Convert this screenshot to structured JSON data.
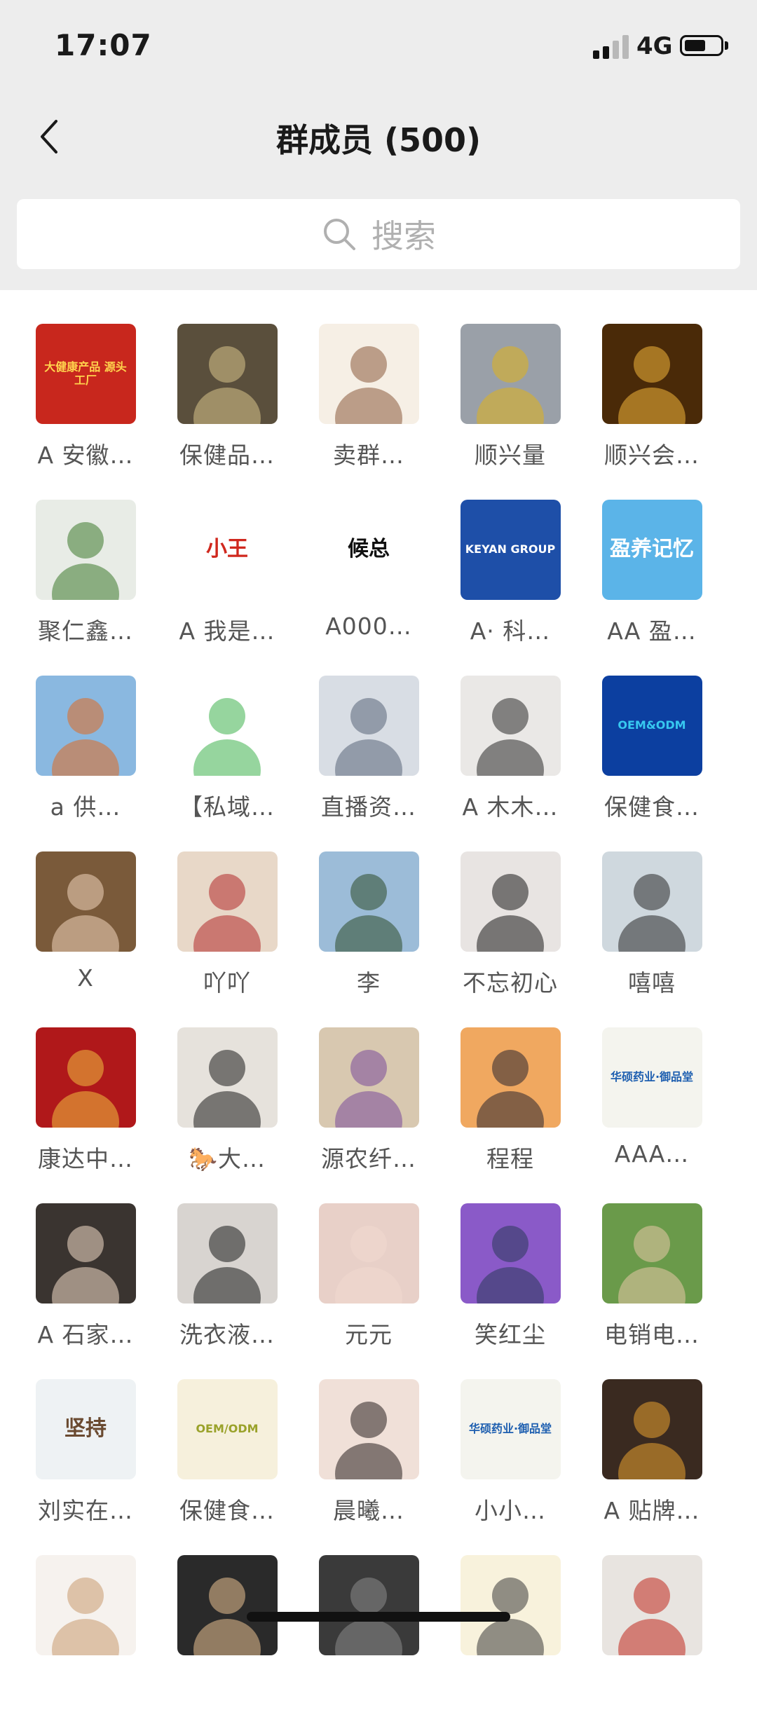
{
  "status_bar": {
    "time": "17:07",
    "network": "4G",
    "battery_level": 0.58
  },
  "header": {
    "title": "群成员 (500)",
    "back_icon": "chevron-left-icon"
  },
  "search": {
    "placeholder": "搜索",
    "icon": "search-icon"
  },
  "members": [
    {
      "name": "A 安徽…",
      "avatar_text": "大健康产品 源头工厂",
      "colors": [
        "#c8271d",
        "#ffd34d"
      ]
    },
    {
      "name": "保健品…",
      "avatar_text": "",
      "colors": [
        "#5a4f3c",
        "#d8c58a"
      ]
    },
    {
      "name": "卖群…",
      "avatar_text": "",
      "colors": [
        "#f6efe5",
        "#8a5a3c"
      ]
    },
    {
      "name": "顺兴量",
      "avatar_text": "",
      "colors": [
        "#9aa0a8",
        "#e0b21a"
      ]
    },
    {
      "name": "顺兴会…",
      "avatar_text": "",
      "colors": [
        "#4a2a08",
        "#f2b43a"
      ]
    },
    {
      "name": "聚仁鑫…",
      "avatar_text": "",
      "colors": [
        "#e8ece6",
        "#3d7a2b"
      ]
    },
    {
      "name": "A 我是…",
      "avatar_text": "小王",
      "colors": [
        "#ffffff",
        "#d0281e"
      ]
    },
    {
      "name": "A000…",
      "avatar_text": "候总",
      "colors": [
        "#ffffff",
        "#111111"
      ]
    },
    {
      "name": "A· 科…",
      "avatar_text": "KEYAN GROUP",
      "colors": [
        "#1e4fa8",
        "#ffffff"
      ]
    },
    {
      "name": "AA 盈…",
      "avatar_text": "盈养记忆",
      "colors": [
        "#5bb4e8",
        "#ffffff"
      ]
    },
    {
      "name": "a 供…",
      "avatar_text": "",
      "colors": [
        "#8ab8e0",
        "#e06a20"
      ]
    },
    {
      "name": "【私域…",
      "avatar_text": "",
      "colors": [
        "#ffffff",
        "#3fb34f"
      ]
    },
    {
      "name": "直播资…",
      "avatar_text": "",
      "colors": [
        "#d8dde4",
        "#5a6478"
      ]
    },
    {
      "name": "A 木木…",
      "avatar_text": "",
      "colors": [
        "#eae8e6",
        "#2a2a2a"
      ]
    },
    {
      "name": "保健食…",
      "avatar_text": "OEM&ODM",
      "colors": [
        "#0c3fa0",
        "#37c8f0"
      ]
    },
    {
      "name": "X",
      "avatar_text": "",
      "colors": [
        "#7a5a3a",
        "#f0d6bc"
      ]
    },
    {
      "name": "吖吖",
      "avatar_text": "",
      "colors": [
        "#e8d8c8",
        "#b02a2a"
      ]
    },
    {
      "name": "李",
      "avatar_text": "",
      "colors": [
        "#9cbcd8",
        "#2e4a2a"
      ]
    },
    {
      "name": "不忘初心",
      "avatar_text": "",
      "colors": [
        "#e8e4e2",
        "#1a1a1a"
      ]
    },
    {
      "name": "嘻嘻",
      "avatar_text": "",
      "colors": [
        "#cfd8de",
        "#2a2a2a"
      ]
    },
    {
      "name": "康达中…",
      "avatar_text": "",
      "colors": [
        "#b0181a",
        "#f0c040"
      ]
    },
    {
      "name": "🐎大…",
      "avatar_text": "",
      "colors": [
        "#e6e2dc",
        "#1c1c1c"
      ]
    },
    {
      "name": "源农纤…",
      "avatar_text": "",
      "colors": [
        "#d8c8b0",
        "#7a4a9a"
      ]
    },
    {
      "name": "程程",
      "avatar_text": "",
      "colors": [
        "#f0a860",
        "#2a2430"
      ]
    },
    {
      "name": "AAA…",
      "avatar_text": "华硕药业·御品堂",
      "colors": [
        "#f4f4ee",
        "#1e5fb0"
      ]
    },
    {
      "name": "A 石家…",
      "avatar_text": "",
      "colors": [
        "#3a3430",
        "#f2dcc8"
      ]
    },
    {
      "name": "洗衣液…",
      "avatar_text": "",
      "colors": [
        "#d8d4d0",
        "#1a1a1a"
      ]
    },
    {
      "name": "元元",
      "avatar_text": "",
      "colors": [
        "#e8d0c8",
        "#f0d8d0"
      ]
    },
    {
      "name": "笑红尘",
      "avatar_text": "",
      "colors": [
        "#8a5ac8",
        "#2a3a5a"
      ]
    },
    {
      "name": "电销电…",
      "avatar_text": "",
      "colors": [
        "#6a9a4a",
        "#e8c8a8"
      ]
    },
    {
      "name": "刘实在…",
      "avatar_text": "坚持",
      "colors": [
        "#eef2f4",
        "#6a4a30"
      ]
    },
    {
      "name": "保健食…",
      "avatar_text": "OEM/ODM",
      "colors": [
        "#f6f0dc",
        "#9aa22a"
      ]
    },
    {
      "name": "晨曦…",
      "avatar_text": "",
      "colors": [
        "#f0e0d8",
        "#2a2020"
      ]
    },
    {
      "name": "小小…",
      "avatar_text": "华硕药业·御品堂",
      "colors": [
        "#f4f4ee",
        "#1e5fb0"
      ]
    },
    {
      "name": "A 贴牌…",
      "avatar_text": "",
      "colors": [
        "#3a2a20",
        "#e8a030"
      ]
    },
    {
      "name": "",
      "avatar_text": "",
      "colors": [
        "#f6f2ee",
        "#c89a70"
      ]
    },
    {
      "name": "",
      "avatar_text": "",
      "colors": [
        "#2a2a2a",
        "#e8c090"
      ]
    },
    {
      "name": "",
      "avatar_text": "",
      "colors": [
        "#3a3a3a",
        "#8a8a8a"
      ]
    },
    {
      "name": "",
      "avatar_text": "",
      "colors": [
        "#f8f2dc",
        "#3a3a3a"
      ]
    },
    {
      "name": "",
      "avatar_text": "",
      "colors": [
        "#e8e4e0",
        "#c0281e"
      ]
    }
  ]
}
